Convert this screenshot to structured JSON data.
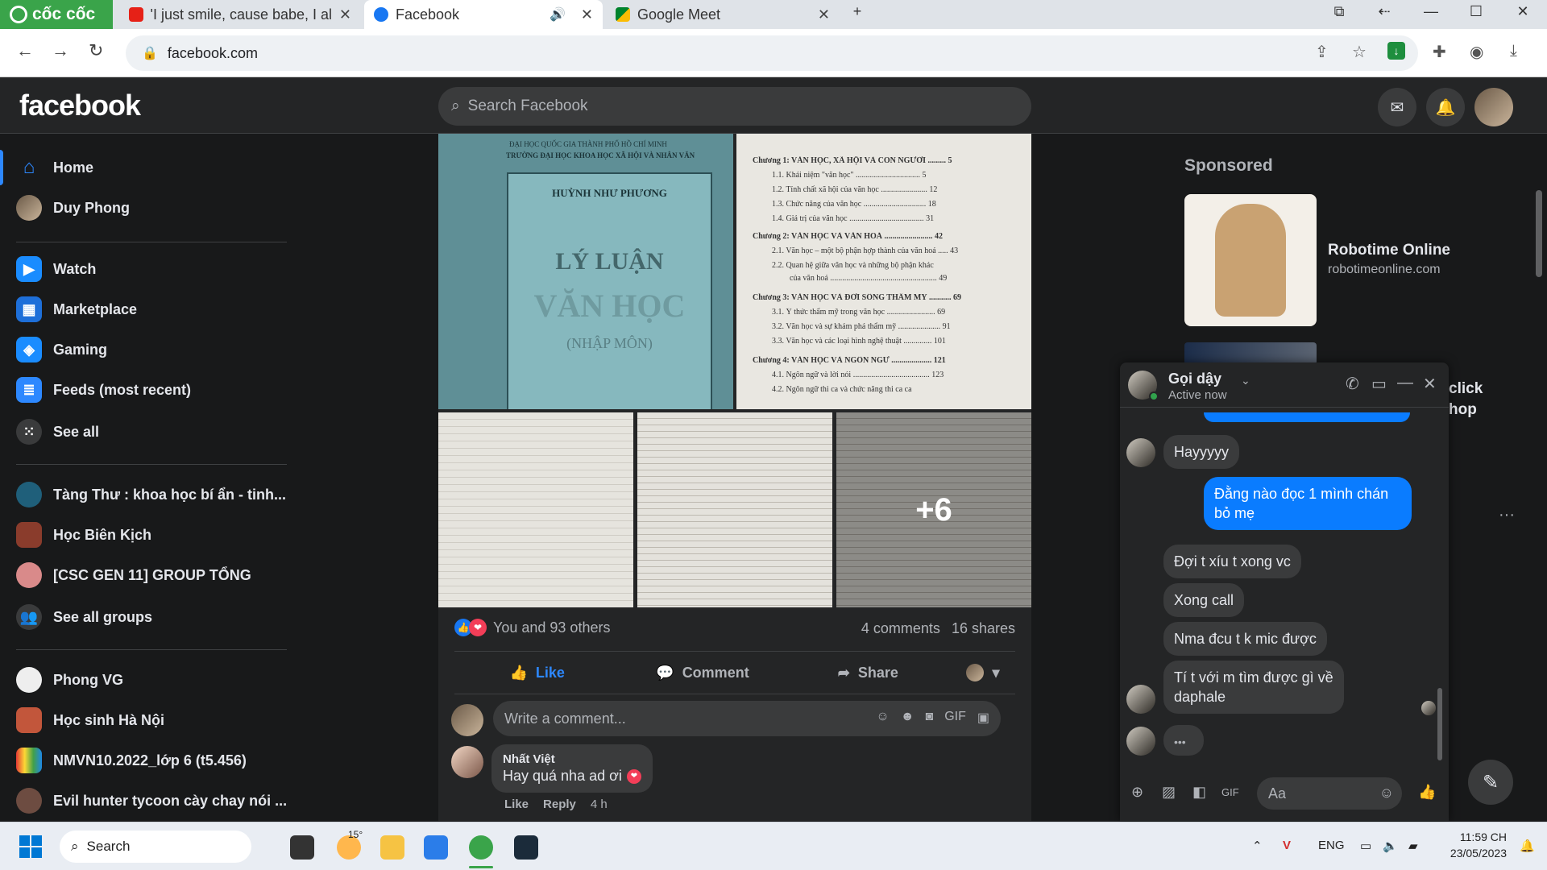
{
  "browser": {
    "brand": "cốc cốc",
    "tabs": [
      {
        "title": "'I just smile, cause babe, I alr"
      },
      {
        "title": "Facebook"
      },
      {
        "title": "Google Meet"
      }
    ],
    "url": "facebook.com"
  },
  "fb": {
    "logo": "facebook",
    "search_placeholder": "Search Facebook"
  },
  "sidebar": {
    "items": [
      {
        "label": "Home",
        "icon": "home-icon"
      },
      {
        "label": "Duy Phong",
        "icon": "profile-avatar"
      },
      {
        "label": "Watch",
        "icon": "watch-icon"
      },
      {
        "label": "Marketplace",
        "icon": "marketplace-icon"
      },
      {
        "label": "Gaming",
        "icon": "gaming-icon"
      },
      {
        "label": "Feeds (most recent)",
        "icon": "feeds-icon"
      },
      {
        "label": "See all",
        "icon": "grid-icon"
      }
    ],
    "groups": [
      {
        "label": "Tàng Thư : khoa học bí ẩn - tinh..."
      },
      {
        "label": "Học Biên Kịch"
      },
      {
        "label": "[CSC GEN 11] GROUP TỔNG"
      },
      {
        "label": "See all groups"
      }
    ],
    "pages": [
      {
        "label": "Phong VG"
      },
      {
        "label": "Học sinh Hà Nội"
      },
      {
        "label": "NMVN10.2022_lớp 6 (t5.456)"
      },
      {
        "label": "Evil hunter tycoon cày chay nói ..."
      }
    ]
  },
  "post": {
    "cover": {
      "header1": "ĐẠI HỌC QUỐC GIA THÀNH PHỐ HỒ CHÍ MINH",
      "header2": "TRƯỜNG ĐẠI HỌC KHOA HỌC XÃ HỘI VÀ NHÂN VĂN",
      "author": "HUỲNH NHƯ PHƯƠNG",
      "title1": "LÝ LUẬN",
      "title2": "VĂN HỌC",
      "subtitle": "(NHẬP MÔN)"
    },
    "toc_lines": [
      "Chương 1: VĂN HỌC, XÃ HỘI VÀ CON NGƯỜI ......... 5",
      "1.1. Khái niệm \"văn học\" ................................ 5",
      "1.2. Tính chất xã hội của văn học ....................... 12",
      "1.3. Chức năng của văn học ............................... 18",
      "1.4. Giá trị của văn học ..................................... 31",
      "Chương 2: VĂN HỌC VÀ VĂN HOÁ ........................ 42",
      "2.1. Văn học – một bộ phận hợp thành của văn hoá ..... 43",
      "2.2. Quan hệ giữa văn học và những bộ phận khác",
      "của văn hoá ..................................................... 49",
      "Chương 3: VĂN HỌC VÀ ĐỜI SỐNG THẨM MỸ ........... 69",
      "3.1. Ý thức thẩm mỹ trong văn học ........................ 69",
      "3.2. Văn học và sự khám phá thẩm mỹ ..................... 91",
      "3.3. Văn học và các loại hình nghệ thuật .............. 101",
      "Chương 4: VĂN HỌC VÀ NGÔN NGỮ .................... 121",
      "4.1. Ngôn ngữ và lời nói ...................................... 123",
      "4.2. Ngôn ngữ thi ca và chức năng thi ca ca"
    ],
    "more_photos": "+6",
    "reactions_text": "You and 93 others",
    "comments_count": "4 comments",
    "shares_count": "16 shares",
    "actions": {
      "like": "Like",
      "comment": "Comment",
      "share": "Share"
    },
    "comment_placeholder": "Write a comment...",
    "comment": {
      "author": "Nhất Việt",
      "text": "Hay quá nha ad ơi",
      "like": "Like",
      "reply": "Reply",
      "time": "4 h"
    }
  },
  "right": {
    "sponsored": "Sponsored",
    "ad_title": "Robotime Online",
    "ad_url": "robotimeonline.com",
    "partial1": "click",
    "partial2": "hop"
  },
  "chat": {
    "name": "Gọi dậy",
    "status": "Active now",
    "messages": [
      {
        "from": "them",
        "text": "Hayyyyy"
      },
      {
        "from": "me",
        "text": "Đằng nào đọc 1 mình chán bỏ mẹ"
      },
      {
        "from": "them",
        "text": "Đợi t xíu t xong vc"
      },
      {
        "from": "them",
        "text": "Xong call"
      },
      {
        "from": "them",
        "text": "Nma đcu t k mic được"
      },
      {
        "from": "them",
        "text": "Tí t với m tìm được gì về daphale"
      }
    ],
    "input_placeholder": "Aa"
  },
  "taskbar": {
    "search": "Search",
    "weather": "15°",
    "lang": "ENG",
    "time": "11:59 CH",
    "date": "23/05/2023"
  }
}
